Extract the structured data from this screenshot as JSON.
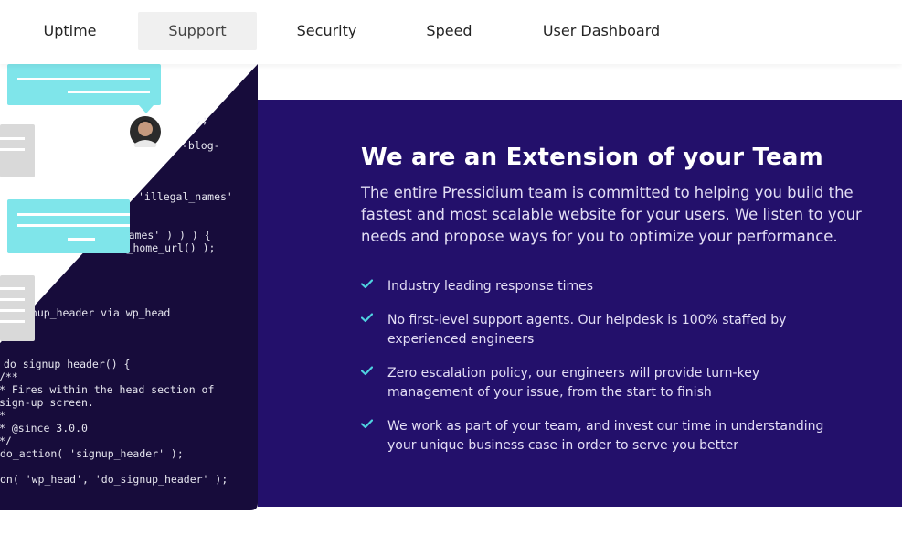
{
  "nav": {
    "tabs": [
      {
        "label": "Uptime"
      },
      {
        "label": "Support",
        "active": true
      },
      {
        "label": "Security"
      },
      {
        "label": "Speed"
      },
      {
        "label": "User Dashboard"
      }
    ]
  },
  "illustration": {
    "code_lines": [
      ");",
      "-blog-",
      "'illegal_names'",
      "gal_names' ) ) ) {",
      "etwork_home_url() );",
      "gnup_header via wp_head",
      "do_signup_header() {",
      "/**",
      " * Fires within the head section of",
      " sign-up screen.",
      " *",
      " * @since 3.0.0",
      " */",
      "do_action( 'signup_header' );",
      "on( 'wp_head', 'do_signup_header' );"
    ]
  },
  "section": {
    "headline": "We are an Extension of your Team",
    "intro": "The entire Pressidium team is committed to helping you build the fastest and most scalable website for your users. We listen to your needs and propose ways for you to optimize your performance.",
    "features": [
      "Industry leading response times",
      "No first-level support agents. Our helpdesk is 100% staffed by experienced engineers",
      "Zero escalation policy, our engineers will provide turn-key management of your issue, from the start to finish",
      "We work as part of your team, and invest our time in understanding your unique business case in order to serve you better"
    ]
  },
  "colors": {
    "panel_bg": "#23106b",
    "code_bg": "#170c3b",
    "accent_check": "#4fd2e0",
    "chat_bubble": "#7fe5ea",
    "card_gray": "#d9d9d9"
  }
}
